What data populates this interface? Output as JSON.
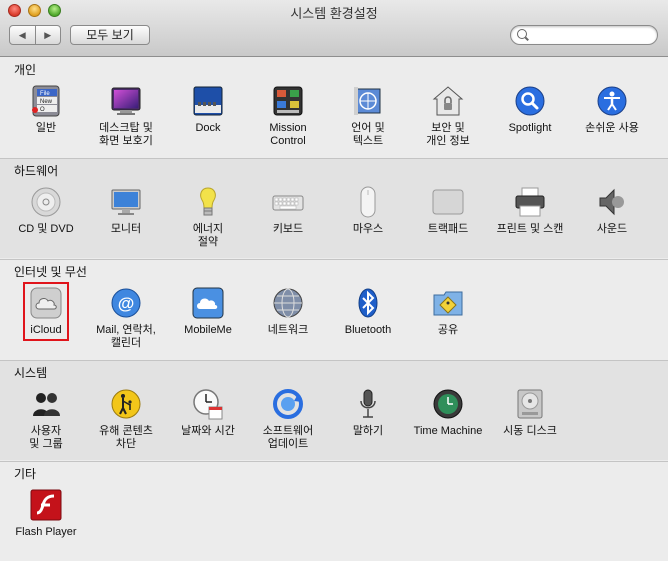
{
  "window": {
    "title": "시스템 환경설정",
    "nav_back": "◀",
    "nav_forward": "▶",
    "show_all": "모두 보기",
    "search_placeholder": ""
  },
  "sections": [
    {
      "title": "개인",
      "items": [
        {
          "label": "일반",
          "icon": "general-icon"
        },
        {
          "label": "데스크탑 및\n화면 보호기",
          "icon": "desktop-screensaver-icon"
        },
        {
          "label": "Dock",
          "icon": "dock-icon"
        },
        {
          "label": "Mission\nControl",
          "icon": "mission-control-icon"
        },
        {
          "label": "언어 및\n텍스트",
          "icon": "language-text-icon"
        },
        {
          "label": "보안 및\n개인 정보",
          "icon": "security-privacy-icon"
        },
        {
          "label": "Spotlight",
          "icon": "spotlight-icon"
        },
        {
          "label": "손쉬운 사용",
          "icon": "accessibility-icon"
        }
      ]
    },
    {
      "title": "하드웨어",
      "items": [
        {
          "label": "CD 및 DVD",
          "icon": "cd-dvd-icon"
        },
        {
          "label": "모니터",
          "icon": "monitor-icon"
        },
        {
          "label": "에너지\n절약",
          "icon": "energy-saver-icon"
        },
        {
          "label": "키보드",
          "icon": "keyboard-icon"
        },
        {
          "label": "마우스",
          "icon": "mouse-icon"
        },
        {
          "label": "트랙패드",
          "icon": "trackpad-icon"
        },
        {
          "label": "프린트 및 스캔",
          "icon": "print-scan-icon"
        },
        {
          "label": "사운드",
          "icon": "sound-icon"
        }
      ]
    },
    {
      "title": "인터넷 및 무선",
      "items": [
        {
          "label": "iCloud",
          "icon": "icloud-icon"
        },
        {
          "label": "Mail, 연락처,\n캘린더",
          "icon": "mail-contacts-icon"
        },
        {
          "label": "MobileMe",
          "icon": "mobileme-icon"
        },
        {
          "label": "네트워크",
          "icon": "network-icon"
        },
        {
          "label": "Bluetooth",
          "icon": "bluetooth-icon"
        },
        {
          "label": "공유",
          "icon": "sharing-icon"
        }
      ]
    },
    {
      "title": "시스템",
      "items": [
        {
          "label": "사용자\n및 그룹",
          "icon": "users-groups-icon"
        },
        {
          "label": "유해 콘텐츠\n차단",
          "icon": "parental-controls-icon"
        },
        {
          "label": "날짜와 시간",
          "icon": "date-time-icon"
        },
        {
          "label": "소프트웨어\n업데이트",
          "icon": "software-update-icon"
        },
        {
          "label": "말하기",
          "icon": "speech-icon"
        },
        {
          "label": "Time Machine",
          "icon": "time-machine-icon"
        },
        {
          "label": "시동 디스크",
          "icon": "startup-disk-icon"
        }
      ]
    },
    {
      "title": "기타",
      "items": [
        {
          "label": "Flash Player",
          "icon": "flash-player-icon"
        }
      ]
    }
  ],
  "general_icon_text": {
    "file": "File",
    "new": "New",
    "o": "O"
  },
  "highlighted_item": "iCloud"
}
